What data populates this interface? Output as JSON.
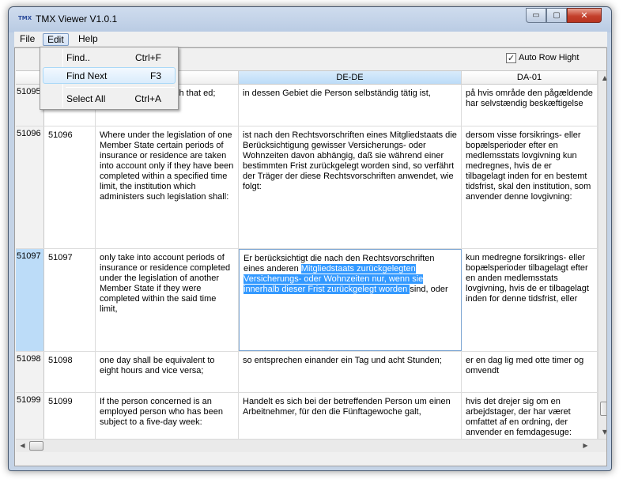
{
  "window": {
    "title": "TMX Viewer V1.0.1",
    "app_icon": "TMX",
    "minimize_glyph": "▭",
    "maximize_glyph": "▢",
    "close_glyph": "✕"
  },
  "menubar": {
    "file": "File",
    "edit": "Edit",
    "help": "Help"
  },
  "toolbar": {
    "auto_row_height_label": "Auto Row Hight",
    "auto_row_height_checked": "✓"
  },
  "grid": {
    "headers": {
      "de": "DE-DE",
      "da": "DA-01"
    },
    "rows": [
      {
        "rowhead": "51095",
        "id": "",
        "en": "ch that ed;",
        "de": "in dessen Gebiet die Person selbständig tätig ist,",
        "da": "på hvis område den pågældende har selvstændig beskæftigelse"
      },
      {
        "rowhead": "51096",
        "id": "51096",
        "en": "Where under the legislation of one Member State certain periods of insurance or residence are taken into account only if they have been completed within a specified time limit, the institution which administers such legislation shall:",
        "de": "ist nach den Rechtsvorschriften eines Mitgliedstaats die Berücksichtigung gewisser Versicherungs- oder Wohnzeiten davon abhängig, daß sie während einer bestimmten Frist zurückgelegt worden sind, so verfährt der Träger der diese Rechtsvorschriften anwendet, wie folgt:",
        "da": "dersom visse forsikrings- eller bopælsperioder efter en medlemsstats lovgivning kun medregnes, hvis de er tilbagelagt inden for en bestemt tidsfrist, skal den institution, som anvender denne lovgivning:"
      },
      {
        "rowhead": "51097",
        "id": "51097",
        "en": "only take into account periods of insurance or residence completed under the legislation of another Member State if they were completed within the said time limit,",
        "de_before": "Er berücksichtigt die nach den Rechtsvorschriften eines anderen ",
        "de_selected": "Mitgliedstaats zurückgelegten Versicherungs- oder Wohnzeiten nur, wenn sie innerhalb dieser Frist zurückgelegt worden ",
        "de_after": "sind, oder",
        "da": "kun medregne forsikrings- eller bopælsperioder tilbagelagt efter en anden medlemsstats lovgivning, hvis de er tilbagelagt inden for denne tidsfrist, eller"
      },
      {
        "rowhead": "51098",
        "id": "51098",
        "en": "one day shall be equivalent to eight hours and vice versa;",
        "de": "so entsprechen einander ein Tag und acht Stunden;",
        "da": "er en dag lig med otte timer og omvendt"
      },
      {
        "rowhead": "51099",
        "id": "51099",
        "en": "If the person concerned is an employed person who has been subject to a five-day week:",
        "de": "Handelt es sich bei der betreffenden Person um einen Arbeitnehmer, für den die Fünftagewoche galt,",
        "da": "hvis det drejer sig om en arbejdstager, der har været omfattet af en ordning, der anvender en femdagesuge:"
      }
    ]
  },
  "scrollbars": {
    "up": "▲",
    "down": "▼",
    "left": "◀",
    "right": "▶"
  },
  "edit_menu": {
    "items": [
      {
        "label": "Find..",
        "shortcut": "Ctrl+F"
      },
      {
        "label": "Find Next",
        "shortcut": "F3"
      },
      {
        "label": "Select All",
        "shortcut": "Ctrl+A"
      }
    ]
  }
}
